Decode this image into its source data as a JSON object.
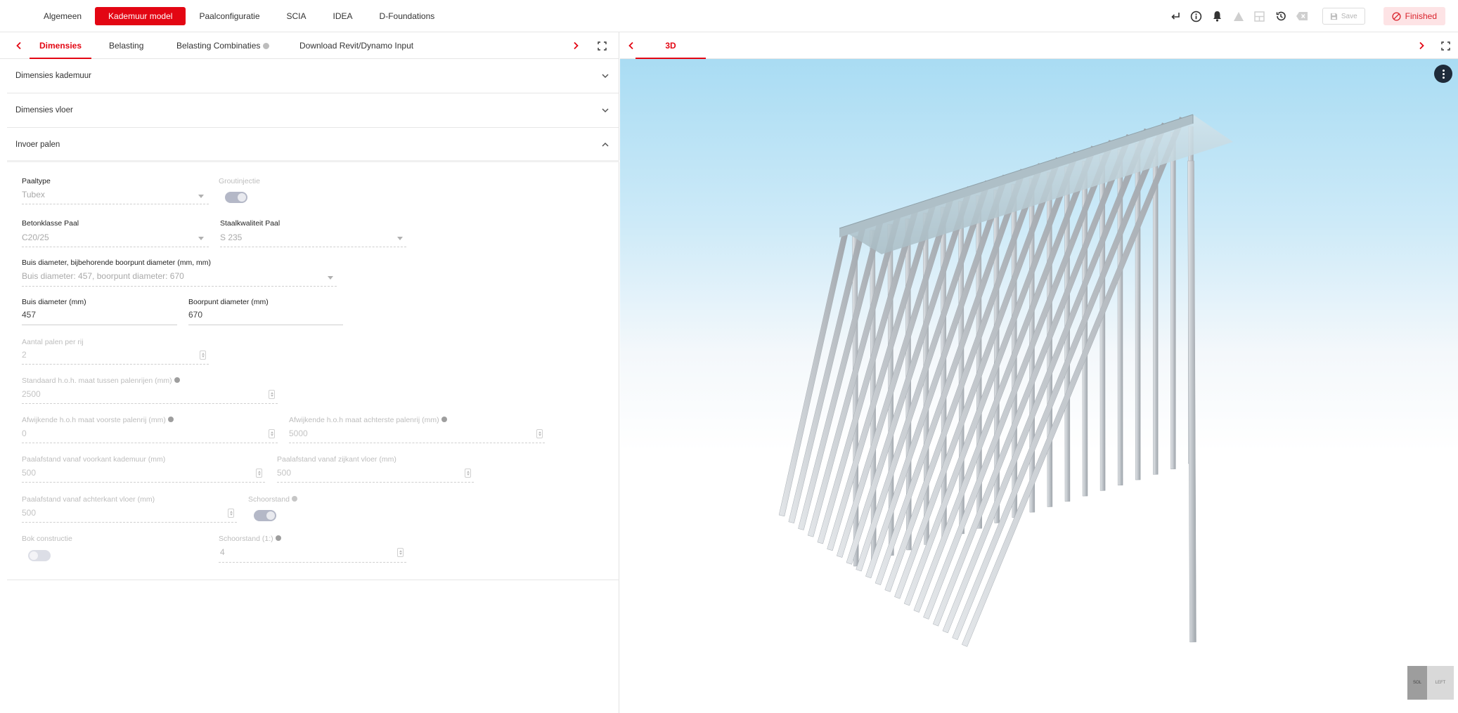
{
  "topbar": {
    "tabs": [
      {
        "label": "Algemeen",
        "active": false
      },
      {
        "label": "Kademuur model",
        "active": true
      },
      {
        "label": "Paalconfiguratie",
        "active": false
      },
      {
        "label": "SCIA",
        "active": false
      },
      {
        "label": "IDEA",
        "active": false
      },
      {
        "label": "D-Foundations",
        "active": false
      }
    ],
    "save_label": "Save",
    "status_label": "Finished",
    "accent_color": "#e30613",
    "icons": [
      "enter-icon",
      "info-icon",
      "bell-icon",
      "warning-icon",
      "layout-icon",
      "history-icon",
      "backspace-icon",
      "save-icon",
      "cancel-circle-icon"
    ]
  },
  "left_panel": {
    "tabs": [
      {
        "label": "Dimensies",
        "active": true
      },
      {
        "label": "Belasting",
        "active": false
      },
      {
        "label": "Belasting Combinaties",
        "active": false,
        "info": true
      },
      {
        "label": "Download Revit/Dynamo Input",
        "active": false
      }
    ],
    "sections": [
      {
        "title": "Dimensies kademuur",
        "expanded": false
      },
      {
        "title": "Dimensies vloer",
        "expanded": false
      },
      {
        "title": "Invoer palen",
        "expanded": true
      }
    ],
    "form": {
      "paaltype": {
        "label": "Paaltype",
        "value": "Tubex"
      },
      "groutinjectie": {
        "label": "Groutinjectie",
        "on": true
      },
      "betonklasse": {
        "label": "Betonklasse Paal",
        "value": "C20/25"
      },
      "staalkwaliteit": {
        "label": "Staalkwaliteit Paal",
        "value": "S 235"
      },
      "buis_combo": {
        "label": "Buis diameter, bijbehorende boorpunt diameter (mm, mm)",
        "value": "Buis diameter: 457, boorpunt diameter: 670"
      },
      "buis_diameter": {
        "label": "Buis diameter (mm)",
        "value": "457"
      },
      "boorpunt_diameter": {
        "label": "Boorpunt diameter (mm)",
        "value": "670"
      },
      "aantal_palen": {
        "label": "Aantal palen per rij",
        "value": "2"
      },
      "standaard_hoh": {
        "label": "Standaard h.o.h. maat tussen palenrijen (mm)",
        "value": "2500"
      },
      "afwijkende_voorste": {
        "label": "Afwijkende h.o.h maat voorste palenrij (mm)",
        "value": "0"
      },
      "afwijkende_achterste": {
        "label": "Afwijkende h.o.h maat achterste palenrij (mm)",
        "value": "5000"
      },
      "paalafstand_voorkant": {
        "label": "Paalafstand vanaf voorkant kademuur (mm)",
        "value": "500"
      },
      "paalafstand_zijkant": {
        "label": "Paalafstand vanaf zijkant vloer (mm)",
        "value": "500"
      },
      "paalafstand_achterkant": {
        "label": "Paalafstand vanaf achterkant vloer (mm)",
        "value": "500"
      },
      "schoorstand": {
        "label": "Schoorstand",
        "on": true
      },
      "bok_constructie": {
        "label": "Bok constructie",
        "on": false
      },
      "schoorstand_value": {
        "label": "Schoorstand (1:)",
        "value": "4"
      }
    }
  },
  "right_panel": {
    "tab_label": "3D",
    "viewcube": {
      "face_a": "SOL",
      "face_b": "LEFT"
    },
    "sky_color": "#a9dcf3",
    "pile_color": "#c9cdd1"
  }
}
